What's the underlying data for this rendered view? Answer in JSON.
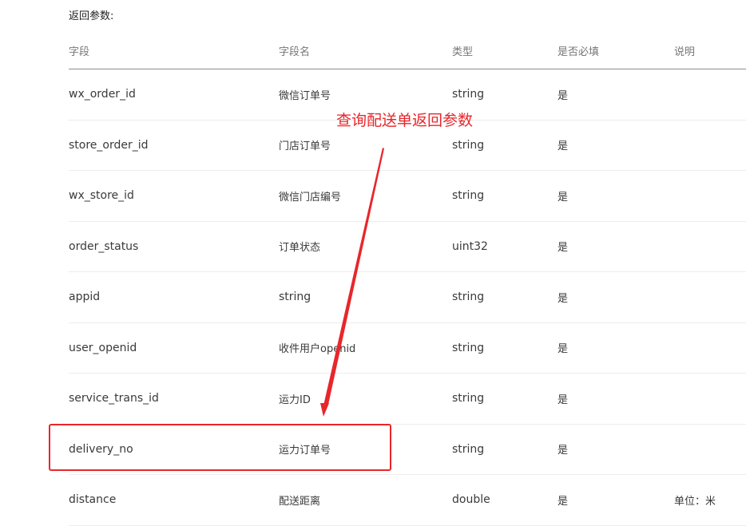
{
  "section_title": "返回参数:",
  "table": {
    "headers": [
      "字段",
      "字段名",
      "类型",
      "是否必填",
      "说明"
    ],
    "rows": [
      {
        "field": "wx_order_id",
        "name": "微信订单号",
        "type": "string",
        "required": "是",
        "desc": ""
      },
      {
        "field": "store_order_id",
        "name": "门店订单号",
        "type": "string",
        "required": "是",
        "desc": ""
      },
      {
        "field": "wx_store_id",
        "name": "微信门店编号",
        "type": "string",
        "required": "是",
        "desc": ""
      },
      {
        "field": "order_status",
        "name": "订单状态",
        "type": "uint32",
        "required": "是",
        "desc": ""
      },
      {
        "field": "appid",
        "name": "string",
        "type": "string",
        "required": "是",
        "desc": ""
      },
      {
        "field": "user_openid",
        "name": "收件用户openid",
        "type": "string",
        "required": "是",
        "desc": ""
      },
      {
        "field": "service_trans_id",
        "name": "运力ID",
        "type": "string",
        "required": "是",
        "desc": ""
      },
      {
        "field": "delivery_no",
        "name": "运力订单号",
        "type": "string",
        "required": "是",
        "desc": ""
      },
      {
        "field": "distance",
        "name": "配送距离",
        "type": "double",
        "required": "是",
        "desc": "单位：米"
      }
    ]
  },
  "annotation": {
    "label": "查询配送单返回参数",
    "color": "#e8262b"
  }
}
